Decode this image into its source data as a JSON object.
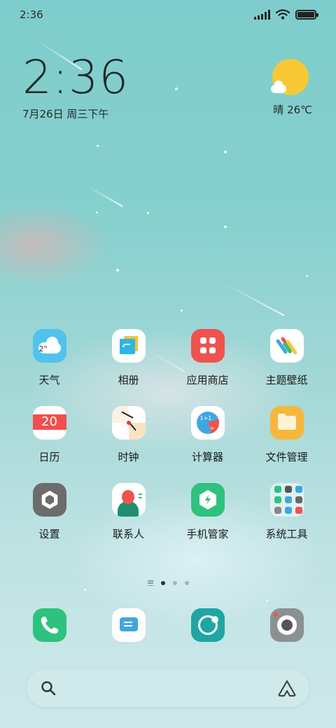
{
  "status_bar": {
    "time": "2:36",
    "battery_level": 1.0
  },
  "clock_widget": {
    "time": "2:36",
    "date": "7月26日 周三下午"
  },
  "weather_widget": {
    "condition_icon": "sun-cloud-icon",
    "text": "晴 26℃"
  },
  "apps": [
    {
      "label": "天气",
      "icon": "weather-icon",
      "icon_text": "2°"
    },
    {
      "label": "相册",
      "icon": "gallery-icon"
    },
    {
      "label": "应用商店",
      "icon": "app-store-icon"
    },
    {
      "label": "主题壁纸",
      "icon": "themes-icon"
    },
    {
      "label": "日历",
      "icon": "calendar-icon",
      "icon_text": "20"
    },
    {
      "label": "时钟",
      "icon": "clock-icon"
    },
    {
      "label": "计算器",
      "icon": "calculator-icon",
      "icon_text": "1+1",
      "icon_text2": "="
    },
    {
      "label": "文件管理",
      "icon": "folder-icon"
    },
    {
      "label": "设置",
      "icon": "settings-icon"
    },
    {
      "label": "联系人",
      "icon": "contacts-icon"
    },
    {
      "label": "手机管家",
      "icon": "security-icon"
    },
    {
      "label": "系统工具",
      "icon": "system-tools-folder-icon"
    }
  ],
  "page_indicator": {
    "pages": 3,
    "current": 1
  },
  "dock": [
    {
      "icon": "phone-icon"
    },
    {
      "icon": "messages-icon"
    },
    {
      "icon": "browser-icon"
    },
    {
      "icon": "camera-icon"
    }
  ],
  "search_bar": {
    "left_icon": "search-icon",
    "right_icon": "assistant-icon"
  },
  "colors": {
    "wallpaper_top": "#7ecdcc",
    "wallpaper_bottom": "#cde8ea",
    "accent_red": "#f0524f",
    "accent_green": "#2ec27e",
    "accent_blue": "#3fa7e0",
    "accent_yellow": "#f8c934"
  }
}
